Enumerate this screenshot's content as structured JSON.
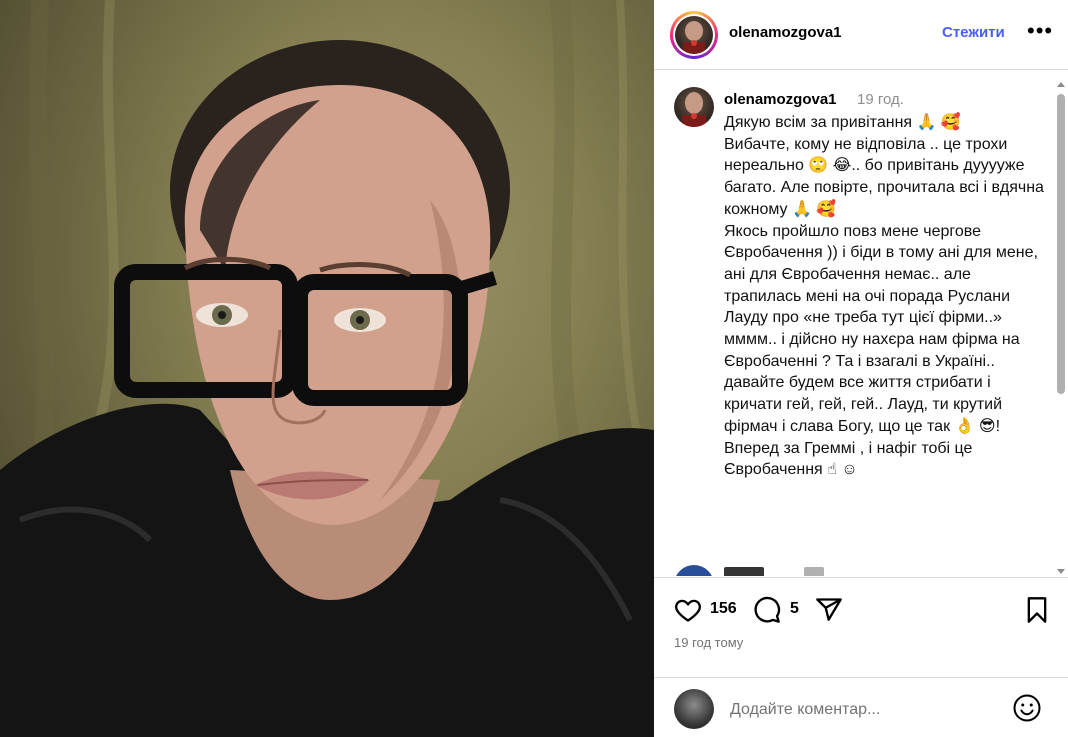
{
  "post": {
    "username": "olenamozgova1",
    "follow_label": "Стежити",
    "more_label": "•••"
  },
  "caption": {
    "username": "olenamozgova1",
    "time": "19 год.",
    "text": "Дякую всім за привітання 🙏 🥰\nВибачте, кому не відповіла .. це трохи нереально 🙄 😂.. бо привітань дууууже багато. Але повірте, прочитала всі і вдячна кожному 🙏 🥰\nЯкось пройшло повз мене чергове Євробачення )) і біди в тому ані для мене, ані для Євробачення немає.. але трапилась мені на очі порада Руслани Лауду про «не треба тут цієї фірми..» мммм.. і дійсно ну нахєра нам фірма на Євробаченні ? Та і взагалі в Україні.. давайте будем все життя стрибати і кричати гей, гей, гей.. Лауд, ти крутий фірмач і слава Богу, що це так 👌 😎! Вперед за Греммі , і нафіг тобі це Євробачення ☝ ☺"
  },
  "stats": {
    "likes": "156",
    "comments": "5",
    "posted": "19 год тому"
  },
  "add_comment": {
    "placeholder": "Додайте коментар..."
  },
  "icons": {
    "like": "heart-icon",
    "comment": "comment-bubble-icon",
    "share": "paper-plane-icon",
    "save": "bookmark-icon",
    "emoji": "smiley-icon",
    "more": "ellipsis-icon"
  },
  "colors": {
    "follow": "#4a5df9",
    "meta": "#8e8e8e",
    "divider": "#dbdbdb"
  }
}
